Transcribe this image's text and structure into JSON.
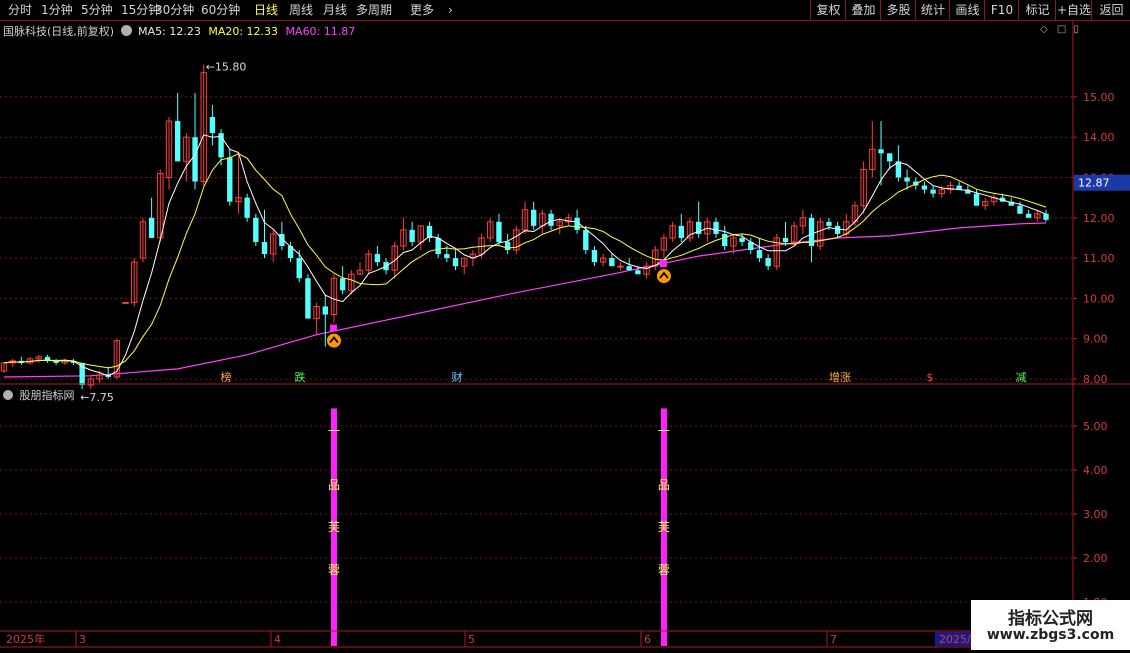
{
  "toolbar": {
    "periods": [
      {
        "label": "分时",
        "active": false
      },
      {
        "label": "1分钟",
        "active": false
      },
      {
        "label": "5分钟",
        "active": false
      },
      {
        "label": "15分钟",
        "active": false
      },
      {
        "label": "30分钟",
        "active": false
      },
      {
        "label": "60分钟",
        "active": false
      },
      {
        "label": "日线",
        "active": true
      },
      {
        "label": "周线",
        "active": false
      },
      {
        "label": "月线",
        "active": false
      },
      {
        "label": "多周期",
        "active": false
      },
      {
        "label": "更多",
        "active": false
      }
    ],
    "right_buttons": [
      "复权",
      "叠加",
      "多股",
      "统计",
      "画线",
      "F10",
      "标记",
      "+自选",
      "返回"
    ]
  },
  "main_chart": {
    "stock_title": "国脉科技(日线,前复权)",
    "ma5": {
      "label": "MA5:",
      "value": "12.23"
    },
    "ma20": {
      "label": "MA20:",
      "value": "12.33"
    },
    "ma60": {
      "label": "MA60:",
      "value": "11.87"
    },
    "y_ticks": [
      "15.00",
      "14.00",
      "13.00",
      "12.00",
      "11.00",
      "10.00",
      "9.00",
      "8.00"
    ],
    "current_price": "12.87",
    "high_label": "15.80",
    "low_label": "7.75",
    "event_labels": [
      "榜",
      "跌",
      "财",
      "增涨",
      "$",
      "减"
    ]
  },
  "indicator": {
    "name": "股朋指标网",
    "y_ticks": [
      "5.00",
      "4.00",
      "3.00",
      "2.00",
      "1.00"
    ],
    "signal_text": [
      "一",
      "品",
      "芙",
      "蓉"
    ]
  },
  "time_axis": {
    "labels": [
      "2025年",
      "3",
      "4",
      "5",
      "6",
      "7",
      "2025/0"
    ]
  },
  "watermark": {
    "line1": "指标公式网",
    "line2": "www.zbgs3.com"
  },
  "colors": {
    "up": "#ff3c3c",
    "down": "#54ffff",
    "ma5": "#ffffff",
    "ma20": "#ffff40",
    "ma60": "#ff40ff",
    "grid": "#7a1515"
  },
  "chart_data": {
    "type": "candlestick",
    "y_range": [
      7.5,
      16.0
    ],
    "ohlc": [
      [
        8.2,
        8.4,
        8.15,
        8.4
      ],
      [
        8.4,
        8.5,
        8.3,
        8.45
      ],
      [
        8.45,
        8.55,
        8.35,
        8.4
      ],
      [
        8.4,
        8.55,
        8.35,
        8.5
      ],
      [
        8.5,
        8.6,
        8.4,
        8.55
      ],
      [
        8.55,
        8.6,
        8.4,
        8.45
      ],
      [
        8.45,
        8.5,
        8.35,
        8.4
      ],
      [
        8.4,
        8.5,
        8.35,
        8.45
      ],
      [
        8.45,
        8.5,
        8.35,
        8.4
      ],
      [
        8.4,
        8.4,
        7.75,
        7.85
      ],
      [
        7.85,
        8.1,
        7.75,
        8.0
      ],
      [
        8.0,
        8.2,
        7.9,
        8.1
      ],
      [
        8.1,
        8.3,
        8.0,
        8.05
      ],
      [
        8.05,
        9.0,
        8.0,
        8.95
      ],
      [
        9.9,
        9.9,
        9.9,
        9.9
      ],
      [
        9.9,
        11.0,
        9.8,
        10.9
      ],
      [
        11.0,
        12.0,
        10.9,
        11.9
      ],
      [
        12.0,
        12.5,
        11.5,
        11.5
      ],
      [
        11.5,
        13.2,
        11.4,
        13.1
      ],
      [
        13.0,
        14.5,
        12.7,
        14.4
      ],
      [
        14.4,
        15.1,
        13.4,
        13.4
      ],
      [
        13.4,
        14.1,
        12.9,
        14.0
      ],
      [
        14.0,
        15.1,
        12.7,
        12.9
      ],
      [
        12.9,
        15.8,
        12.8,
        15.6
      ],
      [
        14.5,
        14.8,
        13.8,
        14.1
      ],
      [
        14.1,
        14.2,
        13.3,
        13.5
      ],
      [
        13.5,
        13.7,
        12.3,
        12.4
      ],
      [
        12.4,
        13.6,
        12.1,
        12.5
      ],
      [
        12.5,
        12.6,
        11.9,
        12.0
      ],
      [
        12.0,
        12.1,
        11.3,
        11.4
      ],
      [
        11.4,
        12.2,
        11.0,
        11.1
      ],
      [
        11.1,
        11.7,
        10.9,
        11.6
      ],
      [
        11.6,
        11.9,
        11.2,
        11.3
      ],
      [
        11.3,
        11.4,
        10.9,
        11.0
      ],
      [
        11.0,
        11.2,
        10.4,
        10.5
      ],
      [
        10.5,
        10.6,
        9.5,
        9.5
      ],
      [
        9.5,
        9.9,
        9.1,
        9.8
      ],
      [
        9.8,
        10.1,
        8.8,
        9.6
      ],
      [
        9.6,
        10.6,
        9.4,
        10.5
      ],
      [
        10.5,
        10.8,
        10.1,
        10.2
      ],
      [
        10.2,
        10.7,
        10.1,
        10.6
      ],
      [
        10.6,
        10.9,
        10.6,
        10.7
      ],
      [
        10.7,
        11.2,
        10.6,
        11.1
      ],
      [
        11.1,
        11.3,
        10.8,
        10.9
      ],
      [
        10.9,
        11.0,
        10.6,
        10.7
      ],
      [
        10.7,
        11.4,
        10.5,
        11.3
      ],
      [
        11.3,
        12.0,
        11.2,
        11.7
      ],
      [
        11.7,
        11.9,
        11.3,
        11.4
      ],
      [
        11.4,
        11.8,
        11.2,
        11.8
      ],
      [
        11.8,
        11.9,
        11.4,
        11.5
      ],
      [
        11.5,
        11.6,
        11.0,
        11.1
      ],
      [
        11.1,
        11.3,
        10.9,
        11.0
      ],
      [
        11.0,
        11.2,
        10.7,
        10.8
      ],
      [
        10.8,
        11.0,
        10.6,
        11.0
      ],
      [
        11.0,
        11.2,
        10.8,
        11.1
      ],
      [
        11.1,
        11.6,
        11.0,
        11.5
      ],
      [
        11.5,
        12.0,
        11.4,
        11.9
      ],
      [
        11.9,
        12.1,
        11.3,
        11.4
      ],
      [
        11.4,
        11.6,
        11.1,
        11.2
      ],
      [
        11.2,
        11.8,
        11.1,
        11.7
      ],
      [
        11.7,
        12.4,
        11.6,
        12.2
      ],
      [
        12.2,
        12.4,
        11.7,
        11.8
      ],
      [
        11.8,
        12.2,
        11.6,
        12.1
      ],
      [
        12.1,
        12.2,
        11.7,
        11.8
      ],
      [
        11.8,
        12.0,
        11.6,
        11.9
      ],
      [
        11.9,
        12.1,
        11.8,
        12.0
      ],
      [
        12.0,
        12.2,
        11.6,
        11.7
      ],
      [
        11.7,
        11.8,
        11.1,
        11.2
      ],
      [
        11.2,
        11.3,
        10.8,
        10.9
      ],
      [
        10.9,
        11.1,
        10.8,
        11.0
      ],
      [
        11.0,
        11.1,
        10.8,
        10.8
      ],
      [
        10.8,
        10.9,
        10.7,
        10.8
      ],
      [
        10.8,
        11.0,
        10.7,
        10.7
      ],
      [
        10.7,
        10.8,
        10.6,
        10.6
      ],
      [
        10.6,
        10.9,
        10.5,
        10.8
      ],
      [
        10.8,
        11.3,
        10.7,
        11.2
      ],
      [
        11.2,
        11.6,
        11.0,
        11.5
      ],
      [
        11.5,
        11.9,
        11.4,
        11.8
      ],
      [
        11.8,
        12.1,
        11.4,
        11.5
      ],
      [
        11.5,
        12.0,
        11.4,
        11.9
      ],
      [
        11.9,
        12.4,
        11.5,
        11.6
      ],
      [
        11.6,
        12.0,
        11.4,
        11.9
      ],
      [
        11.9,
        12.0,
        11.5,
        11.6
      ],
      [
        11.6,
        11.8,
        11.2,
        11.3
      ],
      [
        11.3,
        11.6,
        11.1,
        11.5
      ],
      [
        11.5,
        11.6,
        11.3,
        11.4
      ],
      [
        11.4,
        11.5,
        11.1,
        11.2
      ],
      [
        11.2,
        11.5,
        10.9,
        11.0
      ],
      [
        11.0,
        11.1,
        10.7,
        10.8
      ],
      [
        10.8,
        11.6,
        10.7,
        11.5
      ],
      [
        11.5,
        11.9,
        11.3,
        11.4
      ],
      [
        11.4,
        11.9,
        11.3,
        11.8
      ],
      [
        11.8,
        12.2,
        11.6,
        12.0
      ],
      [
        12.0,
        12.1,
        10.9,
        11.3
      ],
      [
        11.3,
        12.0,
        11.2,
        11.9
      ],
      [
        11.9,
        12.0,
        11.7,
        11.8
      ],
      [
        11.8,
        11.9,
        11.5,
        11.6
      ],
      [
        11.6,
        12.1,
        11.5,
        11.9
      ],
      [
        11.9,
        12.4,
        11.8,
        12.3
      ],
      [
        12.3,
        13.4,
        12.1,
        13.2
      ],
      [
        13.2,
        14.4,
        13.0,
        13.7
      ],
      [
        13.7,
        14.4,
        12.8,
        13.6
      ],
      [
        13.6,
        13.6,
        13.2,
        13.4
      ],
      [
        13.4,
        13.8,
        12.9,
        13.0
      ],
      [
        13.0,
        13.2,
        12.7,
        12.9
      ],
      [
        12.9,
        13.0,
        12.7,
        12.8
      ],
      [
        12.8,
        12.9,
        12.6,
        12.7
      ],
      [
        12.7,
        12.8,
        12.5,
        12.6
      ],
      [
        12.6,
        12.8,
        12.5,
        12.7
      ],
      [
        12.7,
        12.9,
        12.6,
        12.8
      ],
      [
        12.8,
        12.9,
        12.7,
        12.7
      ],
      [
        12.7,
        12.8,
        12.6,
        12.6
      ],
      [
        12.6,
        12.7,
        12.4,
        12.3
      ],
      [
        12.3,
        12.5,
        12.2,
        12.4
      ],
      [
        12.4,
        12.6,
        12.3,
        12.5
      ],
      [
        12.5,
        12.6,
        12.4,
        12.4
      ],
      [
        12.4,
        12.5,
        12.3,
        12.3
      ],
      [
        12.3,
        12.4,
        12.1,
        12.1
      ],
      [
        12.1,
        12.2,
        12.0,
        12.0
      ],
      [
        12.0,
        12.2,
        11.9,
        12.1
      ],
      [
        12.1,
        12.2,
        11.9,
        11.95
      ]
    ],
    "ma60": [
      [
        0,
        8.05
      ],
      [
        10,
        8.08
      ],
      [
        20,
        8.25
      ],
      [
        28,
        8.6
      ],
      [
        36,
        9.1
      ],
      [
        46,
        9.55
      ],
      [
        58,
        10.1
      ],
      [
        70,
        10.6
      ],
      [
        80,
        11.05
      ],
      [
        90,
        11.35
      ],
      [
        96,
        11.5
      ],
      [
        102,
        11.55
      ],
      [
        110,
        11.75
      ],
      [
        117,
        11.85
      ],
      [
        120,
        11.87
      ]
    ],
    "indicator_bars": [
      {
        "index": 38,
        "value": 5.4
      },
      {
        "index": 76,
        "value": 5.4
      }
    ],
    "signal_markers": [
      38,
      76
    ]
  }
}
